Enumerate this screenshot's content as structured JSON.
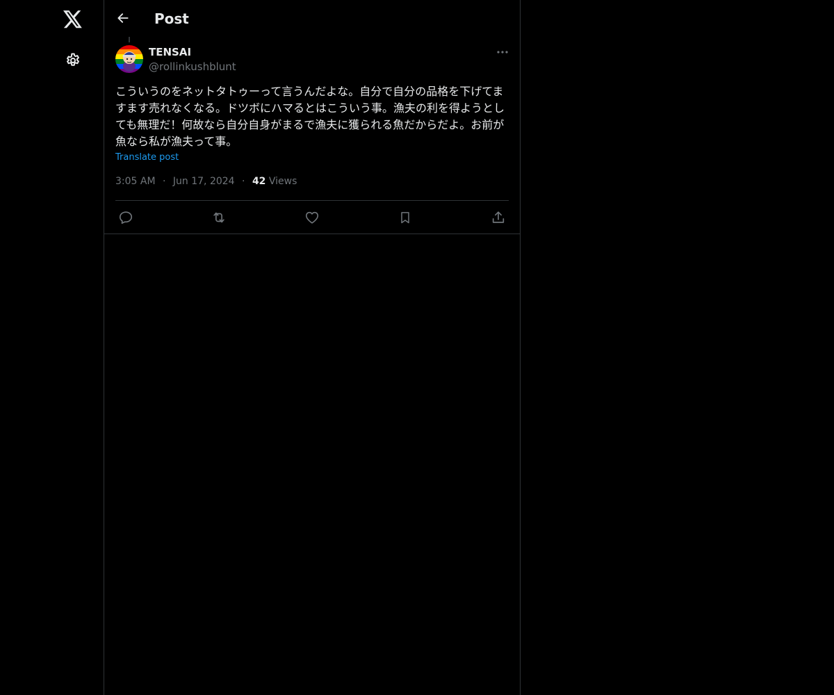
{
  "header": {
    "title": "Post"
  },
  "post": {
    "author": {
      "display_name": "TENSAI",
      "handle": "@rollinkushblunt"
    },
    "text": "こういうのをネットタトゥーって言うんだよな。自分で自分の品格を下げてますます売れなくなる。ドツボにハマるとはこういう事。漁夫の利を得ようとしても無理だ！何故なら自分自身がまるで漁夫に獲られる魚だからだよ。お前が魚なら私が漁夫って事。",
    "translate_label": "Translate post",
    "time": "3:05 AM",
    "date": "Jun 17, 2024",
    "views_count": "42",
    "views_label": "Views",
    "separator": "·"
  },
  "icons": {
    "logo": "x-logo-icon",
    "settings": "gear-icon",
    "back": "arrow-left-icon",
    "more": "more-horizontal-icon",
    "reply": "reply-icon",
    "repost": "repost-icon",
    "like": "heart-icon",
    "bookmark": "bookmark-icon",
    "share": "share-icon"
  },
  "colors": {
    "background": "#000000",
    "text_primary": "#e7e9ea",
    "text_secondary": "#71767b",
    "accent": "#1d9bf0",
    "border": "#2f3336"
  }
}
